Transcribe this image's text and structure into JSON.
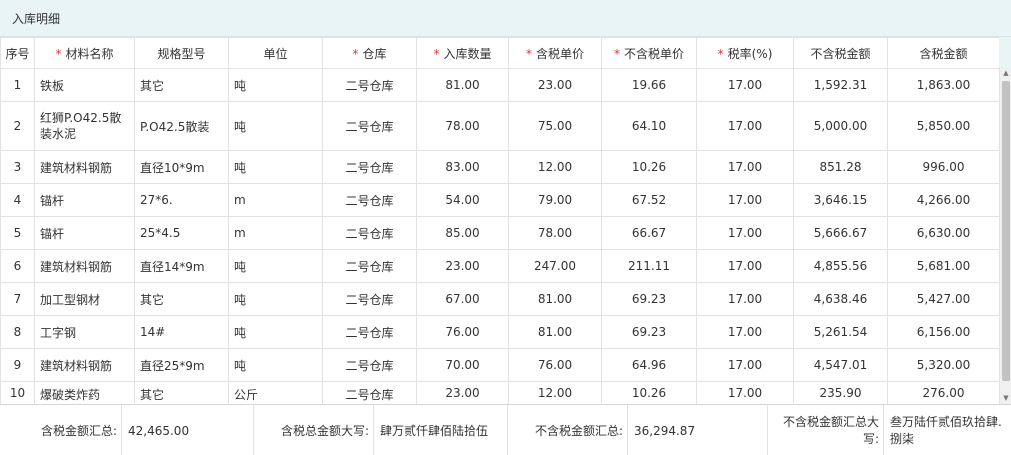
{
  "window": {
    "title": "入库明细"
  },
  "table": {
    "headers": [
      {
        "label": "序号",
        "required": false
      },
      {
        "label": "材料名称",
        "required": true
      },
      {
        "label": "规格型号",
        "required": false
      },
      {
        "label": "单位",
        "required": false
      },
      {
        "label": "仓库",
        "required": true
      },
      {
        "label": "入库数量",
        "required": true
      },
      {
        "label": "含税单价",
        "required": true
      },
      {
        "label": "不含税单价",
        "required": true
      },
      {
        "label": "税率(%)",
        "required": true
      },
      {
        "label": "不含税金额",
        "required": false
      },
      {
        "label": "含税金额",
        "required": false
      }
    ],
    "required_mark": "*",
    "rows": [
      [
        "1",
        "铁板",
        "其它",
        "吨",
        "二号仓库",
        "81.00",
        "23.00",
        "19.66",
        "17.00",
        "1,592.31",
        "1,863.00"
      ],
      [
        "2",
        "红狮P.O42.5散装水泥",
        "P.O42.5散装",
        "吨",
        "二号仓库",
        "78.00",
        "75.00",
        "64.10",
        "17.00",
        "5,000.00",
        "5,850.00"
      ],
      [
        "3",
        "建筑材料钢筋",
        "直径10*9m",
        "吨",
        "二号仓库",
        "83.00",
        "12.00",
        "10.26",
        "17.00",
        "851.28",
        "996.00"
      ],
      [
        "4",
        "锚杆",
        "27*6.",
        "m",
        "二号仓库",
        "54.00",
        "79.00",
        "67.52",
        "17.00",
        "3,646.15",
        "4,266.00"
      ],
      [
        "5",
        "锚杆",
        "25*4.5",
        "m",
        "二号仓库",
        "85.00",
        "78.00",
        "66.67",
        "17.00",
        "5,666.67",
        "6,630.00"
      ],
      [
        "6",
        "建筑材料钢筋",
        "直径14*9m",
        "吨",
        "二号仓库",
        "23.00",
        "247.00",
        "211.11",
        "17.00",
        "4,855.56",
        "5,681.00"
      ],
      [
        "7",
        "加工型钢材",
        "其它",
        "吨",
        "二号仓库",
        "67.00",
        "81.00",
        "69.23",
        "17.00",
        "4,638.46",
        "5,427.00"
      ],
      [
        "8",
        "工字钢",
        "14#",
        "吨",
        "二号仓库",
        "76.00",
        "81.00",
        "69.23",
        "17.00",
        "5,261.54",
        "6,156.00"
      ],
      [
        "9",
        "建筑材料钢筋",
        "直径25*9m",
        "吨",
        "二号仓库",
        "70.00",
        "76.00",
        "64.96",
        "17.00",
        "4,547.01",
        "5,320.00"
      ],
      [
        "10",
        "爆破类炸药",
        "其它",
        "公斤",
        "二号仓库",
        "23.00",
        "12.00",
        "10.26",
        "17.00",
        "235.90",
        "276.00"
      ]
    ]
  },
  "summary": {
    "tax_total_label": "含税金额汇总:",
    "tax_total_value": "42,465.00",
    "tax_total_caps_label": "含税总金额大写:",
    "tax_total_caps_value": "肆万贰仟肆佰陆拾伍",
    "notax_total_label": "不含税金额汇总:",
    "notax_total_value": "36,294.87",
    "notax_total_caps_label": "不含税金额汇总大写:",
    "notax_total_caps_value": "叁万陆仟贰佰玖拾肆.捌柒"
  },
  "colors": {
    "title_bg": "#e9f4f4",
    "required": "#e2353a",
    "border": "#e2e2e2"
  }
}
